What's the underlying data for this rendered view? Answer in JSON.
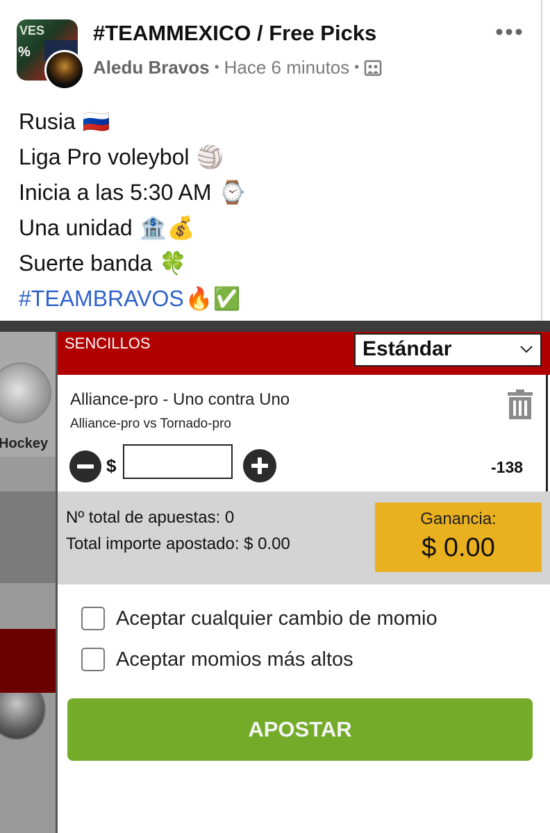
{
  "post": {
    "group_name": "#TEAMMEXICO / Free Picks",
    "author": "Aledu Bravos",
    "time": "Hace 6 minutos",
    "audience_icon": "group-photo-icon",
    "lines": [
      {
        "text": "Rusia",
        "emoji": "🇷🇺"
      },
      {
        "text": "Liga Pro voleybol",
        "emoji": "🏐"
      },
      {
        "text": "Inicia a las 5:30 AM",
        "emoji": "⌚"
      },
      {
        "text": "Una unidad",
        "emoji": "🏦💰"
      },
      {
        "text": "Suerte banda",
        "emoji": "🍀"
      },
      {
        "text": "#TEAMBRAVOS",
        "emoji": "🔥✅"
      }
    ]
  },
  "betslip": {
    "side_label": "Hockey",
    "section_title": "SENCILLOS",
    "mode_select": "Estándar",
    "bet": {
      "title": "Alliance-pro - Uno contra Uno",
      "matchup": "Alliance-pro vs Tornado-pro",
      "currency": "$",
      "stake": "",
      "odds": "-138"
    },
    "summary": {
      "total_bets": "Nº total de apuestas: 0",
      "total_staked": "Total importe apostado: $ 0.00",
      "gain_label": "Ganancia:",
      "gain_value": "$ 0.00"
    },
    "options": [
      "Aceptar cualquier cambio de momio",
      "Aceptar momios más altos"
    ],
    "submit_label": "APOSTAR"
  },
  "colors": {
    "header_red": "#b10000",
    "gain_yellow": "#e9b020",
    "submit_green": "#74ac2a",
    "hashtag_blue": "#2f63c9"
  }
}
